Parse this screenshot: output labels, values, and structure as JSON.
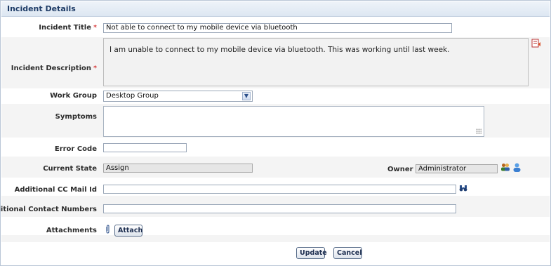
{
  "header": {
    "title": "Incident Details"
  },
  "form": {
    "incident_title": {
      "label": "Incident Title",
      "required_mark": "*",
      "value": "Not able to connect to my mobile device via bluetooth"
    },
    "incident_description": {
      "label": "Incident Description",
      "required_mark": "*",
      "value": "I am unable to connect to my mobile device via bluetooth. This was working until last week."
    },
    "work_group": {
      "label": "Work Group",
      "selected": "Desktop Group"
    },
    "symptoms": {
      "label": "Symptoms",
      "value": ""
    },
    "error_code": {
      "label": "Error Code",
      "value": ""
    },
    "current_state": {
      "label": "Current State",
      "value": "Assign"
    },
    "owner": {
      "label": "Owner",
      "value": "Administrator"
    },
    "additional_cc": {
      "label": "Additional CC Mail Id",
      "value": ""
    },
    "additional_contacts": {
      "label": "Additional Contact Numbers",
      "value": ""
    },
    "attachments": {
      "label": "Attachments",
      "button_label": "Attach"
    }
  },
  "actions": {
    "update_label": "Update",
    "cancel_label": "Cancel"
  },
  "icons": {
    "edit": "edit-document-icon",
    "select_arrow": "chevron-down-icon",
    "users": "users-icon",
    "user": "user-icon",
    "search": "binoculars-icon",
    "attachment": "paperclip-icon"
  },
  "colors": {
    "required": "#cc0000",
    "header_text": "#1d3b66",
    "row_bg": "#f4f4f4"
  }
}
